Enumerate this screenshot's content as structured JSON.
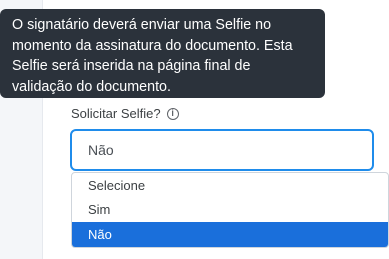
{
  "tooltip": {
    "lines": [
      "O signatário deverá enviar uma Selfie no",
      "momento da assinatura do documento. Esta",
      "Selfie será inserida na página final de",
      "validação do documento."
    ]
  },
  "field": {
    "label": "Solicitar Selfie?",
    "info_icon": "info-icon",
    "value": "Não"
  },
  "dropdown": {
    "options": [
      "Selecione",
      "Sim",
      "Não"
    ],
    "selected_index": 2
  },
  "colors": {
    "tooltip_bg": "#2b323b",
    "focus_border": "#1f8ceb",
    "selected_option_bg": "#1a6fdb"
  }
}
